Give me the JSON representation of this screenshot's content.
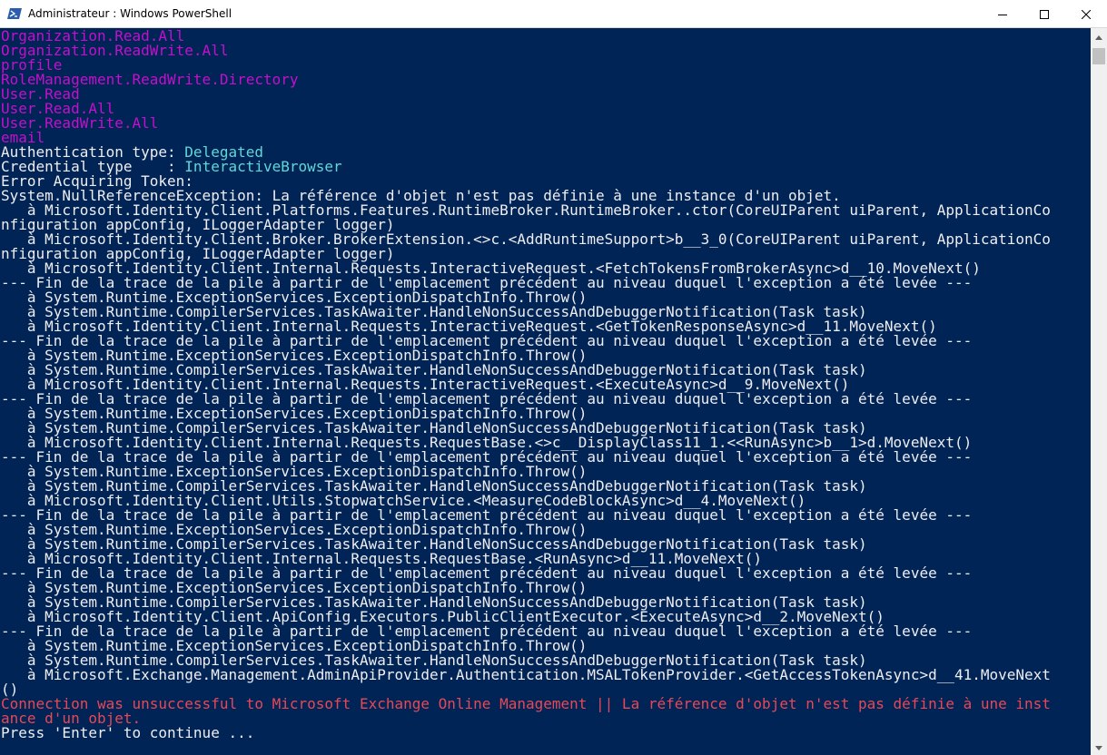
{
  "window": {
    "title": "Administrateur : Windows PowerShell",
    "icons": {
      "app": "powershell-icon",
      "minimize": "minimize-icon",
      "maximize": "maximize-icon",
      "close": "close-icon"
    }
  },
  "colors": {
    "console_bg": "#012456",
    "default_text": "#eeedf0",
    "scope_text": "#c50fcb",
    "value_text": "#61d6d6",
    "error_text": "#e74856"
  },
  "console": {
    "lines": [
      {
        "text": "Organization.Read.All",
        "style": "mag"
      },
      {
        "text": "Organization.ReadWrite.All",
        "style": "mag"
      },
      {
        "text": "profile",
        "style": "mag"
      },
      {
        "text": "RoleManagement.ReadWrite.Directory",
        "style": "mag"
      },
      {
        "text": "User.Read",
        "style": "mag"
      },
      {
        "text": "User.Read.All",
        "style": "mag"
      },
      {
        "text": "User.ReadWrite.All",
        "style": "mag"
      },
      {
        "text": "email",
        "style": "mag"
      },
      {
        "text": "Authentication type: ",
        "style": "",
        "value": "Delegated"
      },
      {
        "text": "Credential type    : ",
        "style": "",
        "value": "InteractiveBrowser"
      },
      {
        "text": "Error Acquiring Token:",
        "style": ""
      },
      {
        "text": "System.NullReferenceException: La référence d'objet n'est pas définie à une instance d'un objet.",
        "style": ""
      },
      {
        "text": "   à Microsoft.Identity.Client.Platforms.Features.RuntimeBroker.RuntimeBroker..ctor(CoreUIParent uiParent, ApplicationCo",
        "style": ""
      },
      {
        "text": "nfiguration appConfig, ILoggerAdapter logger)",
        "style": ""
      },
      {
        "text": "   à Microsoft.Identity.Client.Broker.BrokerExtension.<>c.<AddRuntimeSupport>b__3_0(CoreUIParent uiParent, ApplicationCo",
        "style": ""
      },
      {
        "text": "nfiguration appConfig, ILoggerAdapter logger)",
        "style": ""
      },
      {
        "text": "   à Microsoft.Identity.Client.Internal.Requests.InteractiveRequest.<FetchTokensFromBrokerAsync>d__10.MoveNext()",
        "style": ""
      },
      {
        "text": "--- Fin de la trace de la pile à partir de l'emplacement précédent au niveau duquel l'exception a été levée ---",
        "style": ""
      },
      {
        "text": "   à System.Runtime.ExceptionServices.ExceptionDispatchInfo.Throw()",
        "style": ""
      },
      {
        "text": "   à System.Runtime.CompilerServices.TaskAwaiter.HandleNonSuccessAndDebuggerNotification(Task task)",
        "style": ""
      },
      {
        "text": "   à Microsoft.Identity.Client.Internal.Requests.InteractiveRequest.<GetTokenResponseAsync>d__11.MoveNext()",
        "style": ""
      },
      {
        "text": "--- Fin de la trace de la pile à partir de l'emplacement précédent au niveau duquel l'exception a été levée ---",
        "style": ""
      },
      {
        "text": "   à System.Runtime.ExceptionServices.ExceptionDispatchInfo.Throw()",
        "style": ""
      },
      {
        "text": "   à System.Runtime.CompilerServices.TaskAwaiter.HandleNonSuccessAndDebuggerNotification(Task task)",
        "style": ""
      },
      {
        "text": "   à Microsoft.Identity.Client.Internal.Requests.InteractiveRequest.<ExecuteAsync>d__9.MoveNext()",
        "style": ""
      },
      {
        "text": "--- Fin de la trace de la pile à partir de l'emplacement précédent au niveau duquel l'exception a été levée ---",
        "style": ""
      },
      {
        "text": "   à System.Runtime.ExceptionServices.ExceptionDispatchInfo.Throw()",
        "style": ""
      },
      {
        "text": "   à System.Runtime.CompilerServices.TaskAwaiter.HandleNonSuccessAndDebuggerNotification(Task task)",
        "style": ""
      },
      {
        "text": "   à Microsoft.Identity.Client.Internal.Requests.RequestBase.<>c__DisplayClass11_1.<<RunAsync>b__1>d.MoveNext()",
        "style": ""
      },
      {
        "text": "--- Fin de la trace de la pile à partir de l'emplacement précédent au niveau duquel l'exception a été levée ---",
        "style": ""
      },
      {
        "text": "   à System.Runtime.ExceptionServices.ExceptionDispatchInfo.Throw()",
        "style": ""
      },
      {
        "text": "   à System.Runtime.CompilerServices.TaskAwaiter.HandleNonSuccessAndDebuggerNotification(Task task)",
        "style": ""
      },
      {
        "text": "   à Microsoft.Identity.Client.Utils.StopwatchService.<MeasureCodeBlockAsync>d__4.MoveNext()",
        "style": ""
      },
      {
        "text": "--- Fin de la trace de la pile à partir de l'emplacement précédent au niveau duquel l'exception a été levée ---",
        "style": ""
      },
      {
        "text": "   à System.Runtime.ExceptionServices.ExceptionDispatchInfo.Throw()",
        "style": ""
      },
      {
        "text": "   à System.Runtime.CompilerServices.TaskAwaiter.HandleNonSuccessAndDebuggerNotification(Task task)",
        "style": ""
      },
      {
        "text": "   à Microsoft.Identity.Client.Internal.Requests.RequestBase.<RunAsync>d__11.MoveNext()",
        "style": ""
      },
      {
        "text": "--- Fin de la trace de la pile à partir de l'emplacement précédent au niveau duquel l'exception a été levée ---",
        "style": ""
      },
      {
        "text": "   à System.Runtime.ExceptionServices.ExceptionDispatchInfo.Throw()",
        "style": ""
      },
      {
        "text": "   à System.Runtime.CompilerServices.TaskAwaiter.HandleNonSuccessAndDebuggerNotification(Task task)",
        "style": ""
      },
      {
        "text": "   à Microsoft.Identity.Client.ApiConfig.Executors.PublicClientExecutor.<ExecuteAsync>d__2.MoveNext()",
        "style": ""
      },
      {
        "text": "--- Fin de la trace de la pile à partir de l'emplacement précédent au niveau duquel l'exception a été levée ---",
        "style": ""
      },
      {
        "text": "   à System.Runtime.ExceptionServices.ExceptionDispatchInfo.Throw()",
        "style": ""
      },
      {
        "text": "   à System.Runtime.CompilerServices.TaskAwaiter.HandleNonSuccessAndDebuggerNotification(Task task)",
        "style": ""
      },
      {
        "text": "   à Microsoft.Exchange.Management.AdminApiProvider.Authentication.MSALTokenProvider.<GetAccessTokenAsync>d__41.MoveNext",
        "style": ""
      },
      {
        "text": "()",
        "style": ""
      },
      {
        "text": "Connection was unsuccessful to Microsoft Exchange Online Management || La référence d'objet n'est pas définie à une inst",
        "style": "red"
      },
      {
        "text": "ance d'un objet.",
        "style": "red"
      },
      {
        "text": "Press 'Enter' to continue ...",
        "style": ""
      }
    ]
  },
  "scrollbar": {
    "icons": {
      "up": "scroll-up-arrow-icon",
      "down": "scroll-down-arrow-icon"
    }
  }
}
